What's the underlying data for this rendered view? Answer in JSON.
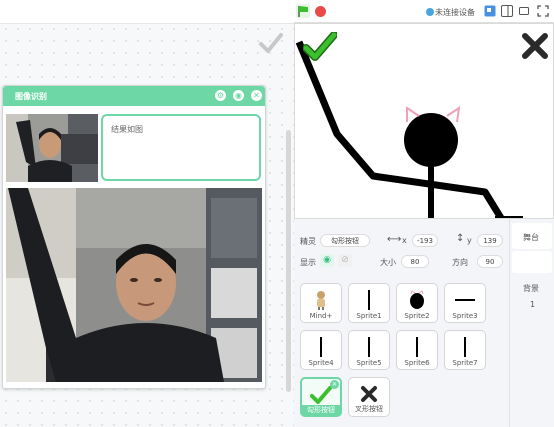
{
  "toolbar": {
    "connection_status": "未连接设备"
  },
  "dialog": {
    "title": "图像识别",
    "result_placeholder": "结果如图"
  },
  "sprite_info": {
    "sprite_label": "精灵",
    "sprite_name": "勾形按钮",
    "x_label": "x",
    "x_value": "-193",
    "y_label": "y",
    "y_value": "139",
    "show_label": "显示",
    "size_label": "大小",
    "size_value": "80",
    "direction_label": "方向",
    "direction_value": "90"
  },
  "sprites": [
    {
      "name": "Mind+",
      "icon": "mind-plus-mascot"
    },
    {
      "name": "Sprite1",
      "icon": "vertical-line"
    },
    {
      "name": "Sprite2",
      "icon": "black-circle"
    },
    {
      "name": "Sprite3",
      "icon": "horizontal-line"
    },
    {
      "name": "Sprite4",
      "icon": "vertical-line"
    },
    {
      "name": "Sprite5",
      "icon": "vertical-line"
    },
    {
      "name": "Sprite6",
      "icon": "vertical-line"
    },
    {
      "name": "Sprite7",
      "icon": "vertical-line"
    },
    {
      "name": "勾形按钮",
      "icon": "check-mark",
      "selected": true
    },
    {
      "name": "叉形按钮",
      "icon": "cross-mark"
    }
  ],
  "stage_panel": {
    "tab": "舞台",
    "backdrop_label": "背景",
    "backdrop_count": "1"
  },
  "colors": {
    "accent": "#6dd8a6",
    "check": "#3bbf2f",
    "stop": "#e94b4b"
  }
}
